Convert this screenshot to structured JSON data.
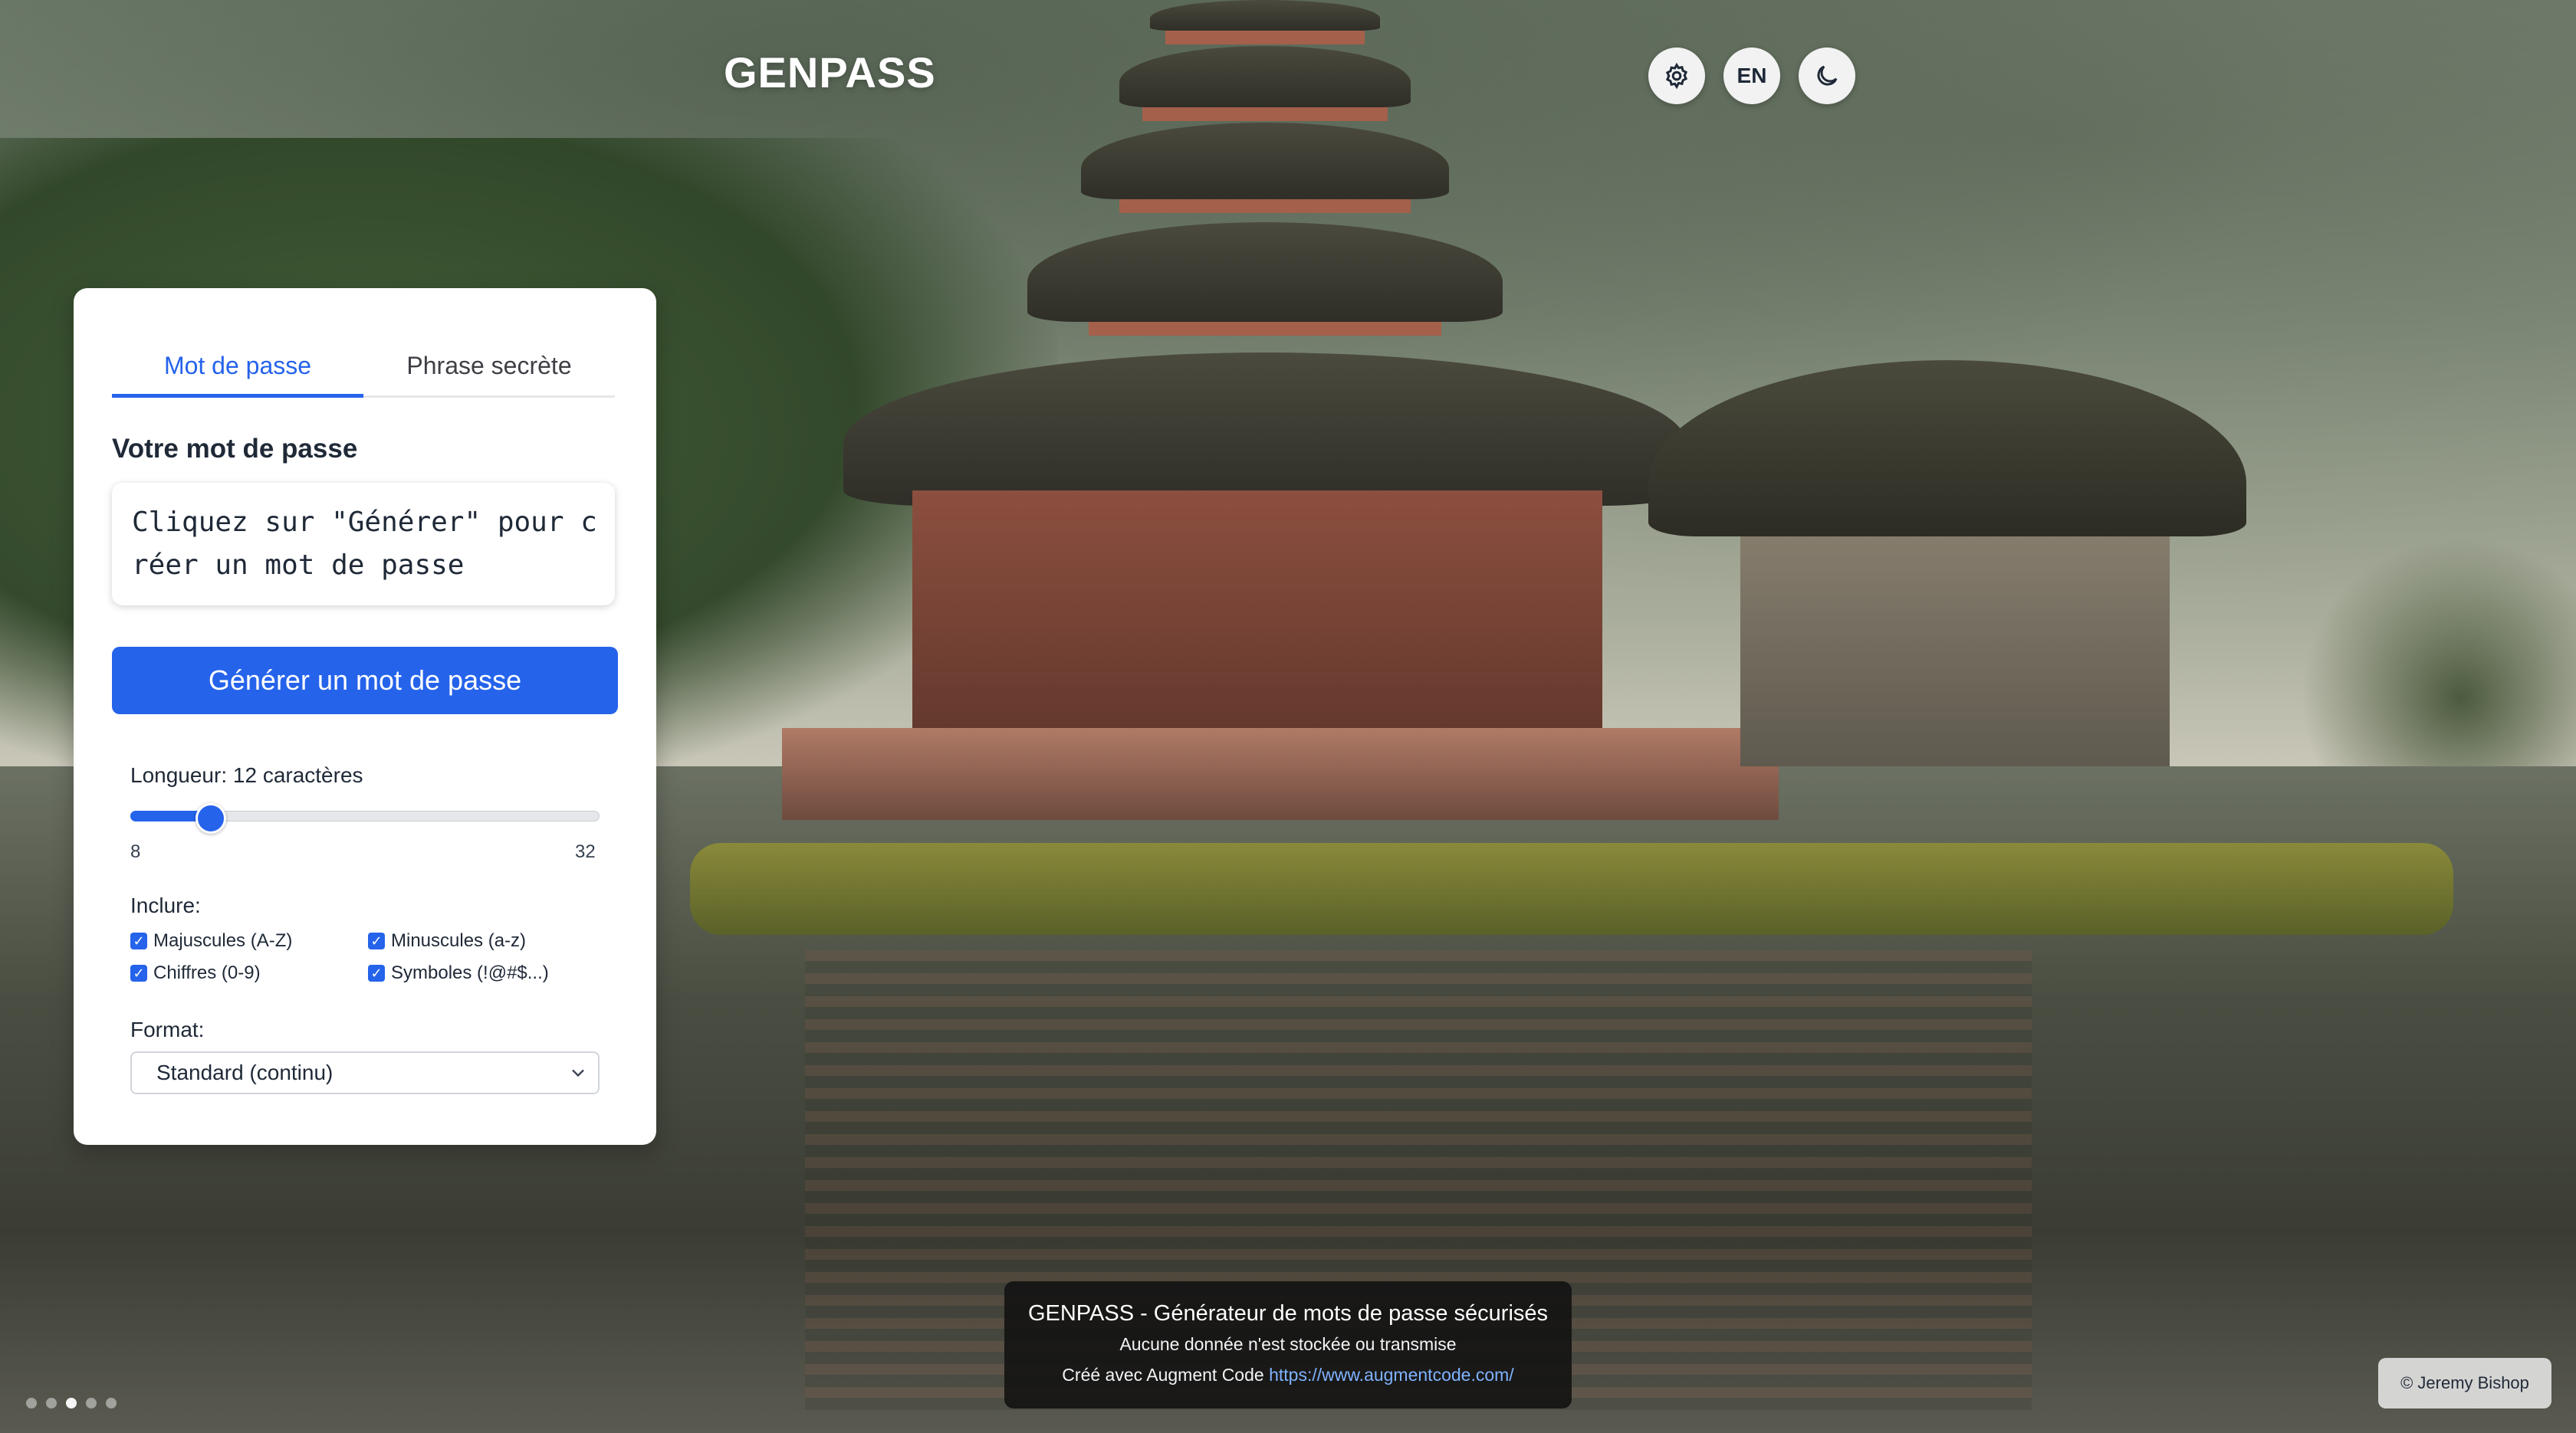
{
  "header": {
    "brand": "GENPASS",
    "language_label": "EN"
  },
  "tabs": [
    {
      "label": "Mot de passe",
      "active": true
    },
    {
      "label": "Phrase secrète",
      "active": false
    }
  ],
  "password_section": {
    "title": "Votre mot de passe",
    "output_text": "Cliquez sur \"Générer\" pour créer un mot de passe",
    "generate_button": "Générer un mot de passe"
  },
  "length": {
    "label": "Longueur: 12 caractères",
    "value": 12,
    "min": 8,
    "max": 32,
    "min_label": "8",
    "max_label": "32"
  },
  "include": {
    "label": "Inclure:",
    "options": [
      {
        "label": "Majuscules (A-Z)",
        "checked": true
      },
      {
        "label": "Minuscules (a-z)",
        "checked": true
      },
      {
        "label": "Chiffres (0-9)",
        "checked": true
      },
      {
        "label": "Symboles (!@#$...)",
        "checked": true
      }
    ]
  },
  "format": {
    "label": "Format:",
    "selected": "Standard (continu)"
  },
  "footer": {
    "title": "GENPASS - Générateur de mots de passe sécurisés",
    "note": "Aucune donnée n'est stockée ou transmise",
    "created_prefix": "Créé avec Augment Code",
    "link": "https://www.augmentcode.com/"
  },
  "photo_credit": "© Jeremy Bishop",
  "carousel": {
    "count": 5,
    "active_index": 2
  },
  "colors": {
    "accent": "#2563eb",
    "footer_bg": "#111111"
  },
  "icons": [
    "gear-icon",
    "moon-icon",
    "chevron-down-icon",
    "check-icon"
  ]
}
